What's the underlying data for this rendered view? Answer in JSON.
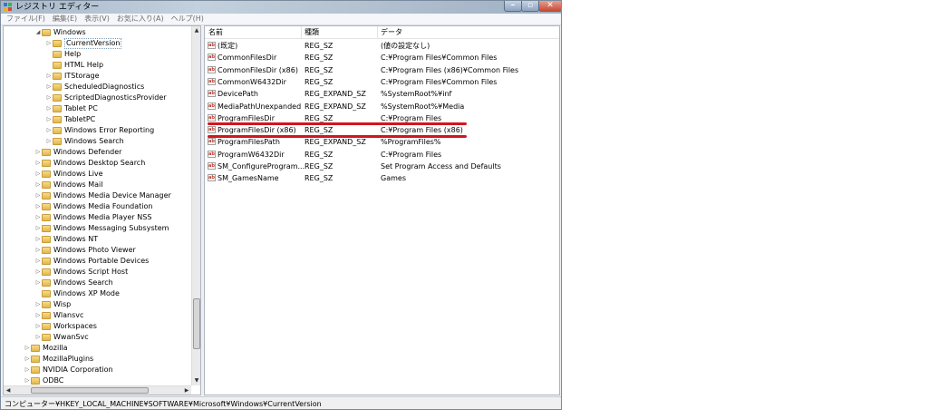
{
  "window": {
    "title": "レジストリ エディター"
  },
  "menu": [
    "ファイル(F)",
    "編集(E)",
    "表示(V)",
    "お気に入り(A)",
    "ヘルプ(H)"
  ],
  "tree": [
    {
      "label": "Windows",
      "indent": 3,
      "exp": "◢"
    },
    {
      "label": "CurrentVersion",
      "indent": 4,
      "exp": "▷",
      "selected": true
    },
    {
      "label": "Help",
      "indent": 4,
      "exp": ""
    },
    {
      "label": "HTML Help",
      "indent": 4,
      "exp": ""
    },
    {
      "label": "ITStorage",
      "indent": 4,
      "exp": "▷"
    },
    {
      "label": "ScheduledDiagnostics",
      "indent": 4,
      "exp": "▷"
    },
    {
      "label": "ScriptedDiagnosticsProvider",
      "indent": 4,
      "exp": "▷"
    },
    {
      "label": "Tablet PC",
      "indent": 4,
      "exp": "▷"
    },
    {
      "label": "TabletPC",
      "indent": 4,
      "exp": "▷"
    },
    {
      "label": "Windows Error Reporting",
      "indent": 4,
      "exp": "▷"
    },
    {
      "label": "Windows Search",
      "indent": 4,
      "exp": "▷"
    },
    {
      "label": "Windows Defender",
      "indent": 3,
      "exp": "▷"
    },
    {
      "label": "Windows Desktop Search",
      "indent": 3,
      "exp": "▷"
    },
    {
      "label": "Windows Live",
      "indent": 3,
      "exp": "▷"
    },
    {
      "label": "Windows Mail",
      "indent": 3,
      "exp": "▷"
    },
    {
      "label": "Windows Media Device Manager",
      "indent": 3,
      "exp": "▷"
    },
    {
      "label": "Windows Media Foundation",
      "indent": 3,
      "exp": "▷"
    },
    {
      "label": "Windows Media Player NSS",
      "indent": 3,
      "exp": "▷"
    },
    {
      "label": "Windows Messaging Subsystem",
      "indent": 3,
      "exp": "▷"
    },
    {
      "label": "Windows NT",
      "indent": 3,
      "exp": "▷"
    },
    {
      "label": "Windows Photo Viewer",
      "indent": 3,
      "exp": "▷"
    },
    {
      "label": "Windows Portable Devices",
      "indent": 3,
      "exp": "▷"
    },
    {
      "label": "Windows Script Host",
      "indent": 3,
      "exp": "▷"
    },
    {
      "label": "Windows Search",
      "indent": 3,
      "exp": "▷"
    },
    {
      "label": "Windows XP Mode",
      "indent": 3,
      "exp": ""
    },
    {
      "label": "Wisp",
      "indent": 3,
      "exp": "▷"
    },
    {
      "label": "Wlansvc",
      "indent": 3,
      "exp": "▷"
    },
    {
      "label": "Workspaces",
      "indent": 3,
      "exp": "▷"
    },
    {
      "label": "WwanSvc",
      "indent": 3,
      "exp": "▷"
    },
    {
      "label": "Mozilla",
      "indent": 2,
      "exp": "▷"
    },
    {
      "label": "MozillaPlugins",
      "indent": 2,
      "exp": "▷"
    },
    {
      "label": "NVIDIA Corporation",
      "indent": 2,
      "exp": "▷"
    },
    {
      "label": "ODBC",
      "indent": 2,
      "exp": "▷"
    }
  ],
  "list": {
    "columns": [
      "名前",
      "種類",
      "データ"
    ],
    "rows": [
      {
        "name": "(既定)",
        "type": "REG_SZ",
        "data": "(値の設定なし)"
      },
      {
        "name": "CommonFilesDir",
        "type": "REG_SZ",
        "data": "C:¥Program Files¥Common Files"
      },
      {
        "name": "CommonFilesDir (x86)",
        "type": "REG_SZ",
        "data": "C:¥Program Files (x86)¥Common Files"
      },
      {
        "name": "CommonW6432Dir",
        "type": "REG_SZ",
        "data": "C:¥Program Files¥Common Files"
      },
      {
        "name": "DevicePath",
        "type": "REG_EXPAND_SZ",
        "data": "%SystemRoot%¥inf"
      },
      {
        "name": "MediaPathUnexpanded",
        "type": "REG_EXPAND_SZ",
        "data": "%SystemRoot%¥Media"
      },
      {
        "name": "ProgramFilesDir",
        "type": "REG_SZ",
        "data": "C:¥Program Files"
      },
      {
        "name": "ProgramFilesDir (x86)",
        "type": "REG_SZ",
        "data": "C:¥Program Files (x86)"
      },
      {
        "name": "ProgramFilesPath",
        "type": "REG_EXPAND_SZ",
        "data": "%ProgramFiles%"
      },
      {
        "name": "ProgramW6432Dir",
        "type": "REG_SZ",
        "data": "C:¥Program Files"
      },
      {
        "name": "SM_ConfigureProgram...",
        "type": "REG_SZ",
        "data": "Set Program Access and Defaults"
      },
      {
        "name": "SM_GamesName",
        "type": "REG_SZ",
        "data": "Games"
      }
    ]
  },
  "status": "コンピューター¥HKEY_LOCAL_MACHINE¥SOFTWARE¥Microsoft¥Windows¥CurrentVersion",
  "colors": {
    "highlight": "#d1171e",
    "folder": "#e3b64a"
  }
}
